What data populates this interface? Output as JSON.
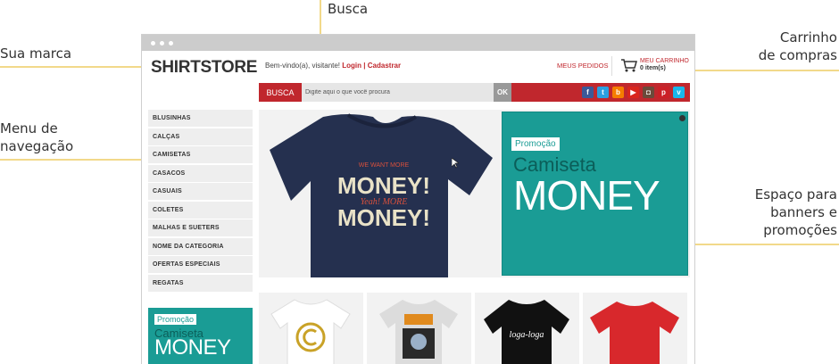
{
  "annotations": {
    "brand": "Sua marca",
    "search": "Busca",
    "nav_line1": "Menu de",
    "nav_line2": "navegação",
    "cart_line1": "Carrinho",
    "cart_line2": "de compras",
    "banner_line1": "Espaço para",
    "banner_line2": "banners e",
    "banner_line3": "promoções"
  },
  "header": {
    "logo": "SHIRTSTORE",
    "welcome": "Bem-vindo(a), visitante!",
    "login": "Login",
    "divider": "|",
    "register": "Cadastrar",
    "orders": "MEUS PEDIDOS",
    "cart_label": "MEU CARRINHO",
    "cart_count": "0 item(s)"
  },
  "search": {
    "button": "BUSCA",
    "placeholder": "Digite aqui o que você procura",
    "ok": "OK"
  },
  "socials": [
    {
      "icon": "facebook-icon",
      "glyph": "f",
      "color": "#3b5998"
    },
    {
      "icon": "twitter-icon",
      "glyph": "t",
      "color": "#2b9fe0"
    },
    {
      "icon": "blogger-icon",
      "glyph": "b",
      "color": "#f57d00"
    },
    {
      "icon": "youtube-icon",
      "glyph": "▶",
      "color": "#d9251d"
    },
    {
      "icon": "instagram-icon",
      "glyph": "◘",
      "color": "#6b4a3a"
    },
    {
      "icon": "pinterest-icon",
      "glyph": "p",
      "color": "#cb2027"
    },
    {
      "icon": "vimeo-icon",
      "glyph": "v",
      "color": "#1ab7ea"
    }
  ],
  "nav": [
    "BLUSINHAS",
    "CALÇAS",
    "CAMISETAS",
    "CASACOS",
    "CASUAIS",
    "COLETES",
    "MALHAS E SUETERS",
    "NOME DA CATEGORIA",
    "OFERTAS ESPECIAIS",
    "REGATAS"
  ],
  "banner": {
    "tag": "Promoção",
    "line1": "Camiseta",
    "line2": "MONEY",
    "shirt_text": {
      "top": "WE WANT MORE",
      "line1": "MONEY!",
      "yeah": "Yeah! MORE",
      "line2": "MONEY!"
    }
  },
  "side_promo": {
    "tag": "Promoção",
    "line1": "Camiseta",
    "line2": "MONEY"
  },
  "thumbs": {
    "shirt3_text": "loga-loga"
  },
  "colors": {
    "brand_red": "#c0272d",
    "teal": "#1a9c95",
    "annotation": "#f2c94c"
  }
}
